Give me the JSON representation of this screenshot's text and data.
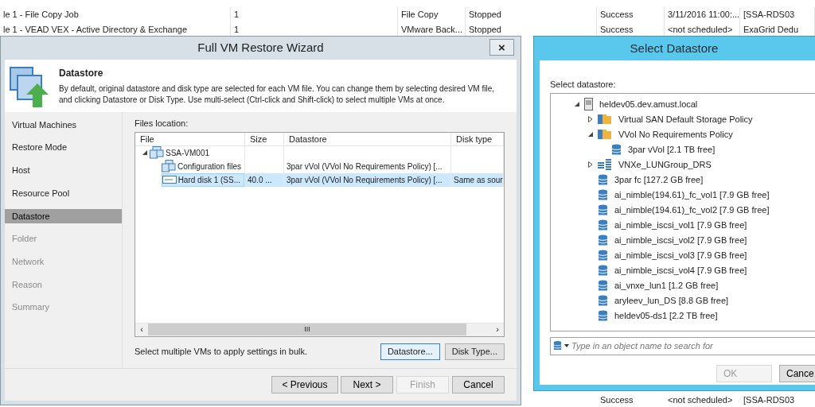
{
  "background_table": {
    "rows": [
      {
        "cells": [
          "le 1 - File Copy Job",
          "1",
          "File Copy",
          "Stopped",
          "Success",
          "3/11/2016 11:00:...",
          "[SSA-RDS03"
        ]
      },
      {
        "cells": [
          "le 1 - VEAD VEX - Active Directory & Exchange",
          "1",
          "VMware Back...",
          "Stopped",
          "Success",
          "<not scheduled>",
          "ExaGrid Dedu"
        ]
      }
    ],
    "bottom_row": {
      "cells": [
        "Success",
        "<not scheduled>",
        "[SSA-RDS03"
      ]
    }
  },
  "wizard": {
    "title": "Full VM Restore Wizard",
    "close": "×",
    "header": {
      "title": "Datastore",
      "description": "By default, original datastore and disk type are selected for each VM file. You can change them by selecting desired VM file, and clicking Datastore or Disk Type. Use multi-select (Ctrl-click and Shift-click) to select multiple VMs at once."
    },
    "steps": [
      {
        "label": "Virtual Machines",
        "selected": false,
        "disabled": false
      },
      {
        "label": "Restore Mode",
        "selected": false,
        "disabled": false
      },
      {
        "label": "Host",
        "selected": false,
        "disabled": false
      },
      {
        "label": "Resource Pool",
        "selected": false,
        "disabled": false
      },
      {
        "label": "Datastore",
        "selected": true,
        "disabled": false
      },
      {
        "label": "Folder",
        "selected": false,
        "disabled": true
      },
      {
        "label": "Network",
        "selected": false,
        "disabled": true
      },
      {
        "label": "Reason",
        "selected": false,
        "disabled": true
      },
      {
        "label": "Summary",
        "selected": false,
        "disabled": true
      }
    ],
    "files_label": "Files location:",
    "files_table": {
      "columns": [
        "File",
        "Size",
        "Datastore",
        "Disk type"
      ],
      "rows": [
        {
          "kind": "vm",
          "cells": [
            "SSA-VM001",
            "",
            "",
            ""
          ],
          "expanded": true,
          "selected": false,
          "children": [
            {
              "kind": "config",
              "cells": [
                "Configuration files",
                "",
                "3par vVol (VVol No Requirements Policy) [...",
                ""
              ],
              "selected": false
            },
            {
              "kind": "disk",
              "cells": [
                "Hard disk 1 (SS...",
                "40.0 ...",
                "3par vVol (VVol No Requirements Policy) [...",
                "Same as sour"
              ],
              "selected": true
            }
          ]
        }
      ],
      "scroll_grip": "III",
      "scroll_left": "‹",
      "scroll_right": "›"
    },
    "hint": "Select multiple VMs to apply settings in bulk.",
    "actions": [
      {
        "label": "Datastore...",
        "disabled": false,
        "focused": true
      },
      {
        "label": "Disk Type...",
        "disabled": false,
        "focused": false
      }
    ],
    "buttons": [
      {
        "label": "< Previous",
        "disabled": false
      },
      {
        "label": "Next >",
        "disabled": false
      },
      {
        "label": "Finish",
        "disabled": true
      },
      {
        "label": "Cancel",
        "disabled": false
      }
    ]
  },
  "select_dialog": {
    "title": "Select Datastore",
    "label": "Select datastore:",
    "tree": [
      {
        "kind": "host",
        "label": "heldev05.dev.amust.local",
        "expanded": true,
        "children": [
          {
            "kind": "policy",
            "label": "Virtual SAN Default Storage Policy",
            "expanded": false
          },
          {
            "kind": "policy",
            "label": "VVol No Requirements Policy",
            "expanded": true,
            "children": [
              {
                "kind": "datastore",
                "label": "3par vVol [2.1 TB free]"
              }
            ]
          },
          {
            "kind": "cluster",
            "label": "VNXe_LUNGroup_DRS",
            "expanded": false
          },
          {
            "kind": "datastore",
            "label": "3par fc [127.2 GB free]"
          },
          {
            "kind": "datastore",
            "label": "ai_nimble(194.61)_fc_vol1 [7.9 GB free]"
          },
          {
            "kind": "datastore",
            "label": "ai_nimble(194.61)_fc_vol2 [7.9 GB free]"
          },
          {
            "kind": "datastore",
            "label": "ai_nimble_iscsi_vol1 [7.9 GB free]"
          },
          {
            "kind": "datastore",
            "label": "ai_nimble_iscsi_vol2 [7.9 GB free]"
          },
          {
            "kind": "datastore",
            "label": "ai_nimble_iscsi_vol3 [7.9 GB free]"
          },
          {
            "kind": "datastore",
            "label": "ai_nimble_iscsi_vol4 [7.9 GB free]"
          },
          {
            "kind": "datastore",
            "label": "ai_vnxe_lun1 [1.2 GB free]"
          },
          {
            "kind": "datastore",
            "label": "aryleev_lun_DS [8.8 GB free]"
          },
          {
            "kind": "datastore",
            "label": "heldev05-ds1 [2.2 TB free]"
          }
        ]
      }
    ],
    "search": {
      "placeholder": "Type in an object name to search for"
    },
    "buttons": [
      {
        "label": "OK",
        "disabled": true
      },
      {
        "label": "Cance",
        "disabled": false
      }
    ]
  }
}
